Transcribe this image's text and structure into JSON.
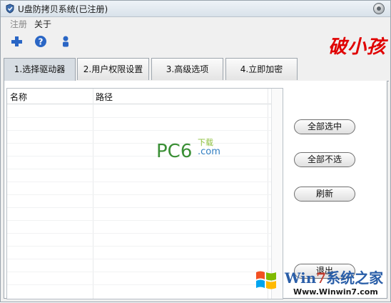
{
  "window": {
    "title": "U盘防拷贝系统(已注册)"
  },
  "menu": [
    {
      "label": "注册",
      "disabled": true
    },
    {
      "label": "关于",
      "disabled": false
    }
  ],
  "toolbar": {
    "icons": [
      "plus-icon",
      "help-icon",
      "user-icon"
    ]
  },
  "brand": {
    "text": "破小孩"
  },
  "tabs": [
    {
      "label": "1.选择驱动器",
      "active": true
    },
    {
      "label": "2.用户权限设置",
      "active": false
    },
    {
      "label": "3.高级选项",
      "active": false
    },
    {
      "label": "4.立即加密",
      "active": false
    }
  ],
  "drive_list": {
    "columns": [
      "名称",
      "路径"
    ],
    "rows": []
  },
  "watermark": {
    "main": "PC6",
    "sub": "下载",
    "com": ".com"
  },
  "buttons": {
    "select_all": "全部选中",
    "select_none": "全部不选",
    "refresh": "刷新",
    "exit": "退出"
  },
  "win7_badge": {
    "text": "系统之家",
    "win": "Win",
    "url": "Www.Winwin7.com"
  },
  "colors": {
    "brand": "#e00000",
    "watermark_green": "#3a8f35",
    "win7_blue": "#2a5ea8"
  }
}
